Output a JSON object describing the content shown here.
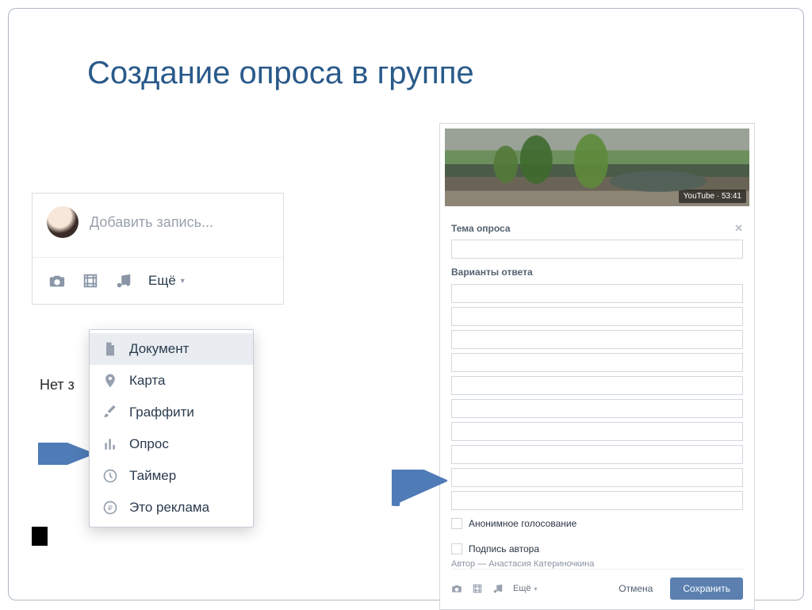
{
  "slide": {
    "title": "Создание опроса в группе"
  },
  "left": {
    "compose_placeholder": "Добавить запись...",
    "more_label": "Ещё",
    "partial_text": "Нет з",
    "menu": [
      {
        "icon": "document-icon",
        "label": "Документ"
      },
      {
        "icon": "map-pin-icon",
        "label": "Карта"
      },
      {
        "icon": "brush-icon",
        "label": "Граффити"
      },
      {
        "icon": "poll-icon",
        "label": "Опрос"
      },
      {
        "icon": "clock-icon",
        "label": "Таймер"
      },
      {
        "icon": "ruble-icon",
        "label": "Это реклама"
      }
    ]
  },
  "right": {
    "video_badge": "YouTube · 53:41",
    "poll_topic_label": "Тема опроса",
    "answers_label": "Варианты ответа",
    "option_count": 10,
    "anon_label": "Анонимное голосование",
    "signature_label": "Подпись автора",
    "author_line": "Автор — Анастасия Катериночкина",
    "more_label": "Ещё",
    "cancel_label": "Отмена",
    "save_label": "Сохранить"
  }
}
